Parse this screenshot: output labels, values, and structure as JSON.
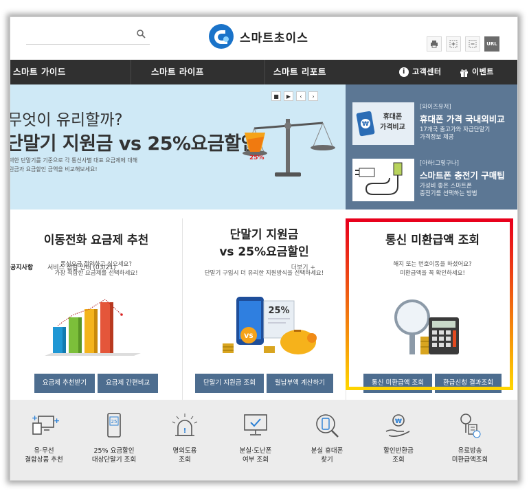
{
  "header": {
    "logo_text": "스마트초이스",
    "search_placeholder": "",
    "tools": [
      "print-icon",
      "zoom-in-icon",
      "zoom-out-icon",
      "url-icon"
    ],
    "url_label": "URL"
  },
  "nav": {
    "items": [
      "스마트 가이드",
      "스마트 라이프",
      "스마트 리포트"
    ],
    "support": "고객센터",
    "event": "이벤트"
  },
  "banner": {
    "subtitle": "무엇이 유리할까?",
    "title": "단말기 지원금 vs 25%요금할인",
    "desc_line1": "택한 단말기를 기준으로 각 통신사별 대표 요금제에 대해",
    "desc_line2": "원금과 요금할인 금액을 비교해보세요!",
    "badge": "25%",
    "notice_label": "공지사항",
    "notice_text": "서비스 점검 안내 (03/21)",
    "notice_more": "더보기 +"
  },
  "side": {
    "cards": [
      {
        "thumb_label_1": "휴대폰",
        "thumb_label_2": "가격비교",
        "tag": "[와이즈유저]",
        "title": "휴대폰 가격 국내외비교",
        "desc_1": "17개국 출고가와 자급단말기",
        "desc_2": "가격정보 제공"
      },
      {
        "tag": "[아하!그렇구나]",
        "title": "스마트폰 충전기 구매팁",
        "desc_1": "가성비 좋은 스마트폰",
        "desc_2": "충전기를 선택하는 방법"
      }
    ]
  },
  "features": [
    {
      "title_1": "이동전화 요금제 추천",
      "title_2": "",
      "desc_1": "통신요금 절약하고 싶으세요?",
      "desc_2": "가장 적합한 요금제를 선택하세요!",
      "buttons": [
        "요금제 추천받기",
        "요금제 간편비교"
      ]
    },
    {
      "title_1": "단말기 지원금",
      "title_2": "vs 25%요금할인",
      "desc_1": "단말기 구입시 더 유리한 지원방식을 선택하세요!",
      "desc_2": "",
      "buttons": [
        "단말기 지원금 조회",
        "월납부액 계산하기"
      ],
      "badge_vs": "VS",
      "badge_pct": "25%"
    },
    {
      "title_1": "통신 미환급액 조회",
      "title_2": "",
      "desc_1": "해지 또는 번호이동을 하셨어요?",
      "desc_2": "미환급액을 꼭 확인하세요!",
      "buttons": [
        "통신 미환급액 조회",
        "환급신청 결과조회"
      ]
    }
  ],
  "quick": [
    {
      "l1": "유·무선",
      "l2": "결합상품 추천",
      "icon": "devices-icon"
    },
    {
      "l1": "25% 요금할인",
      "l2": "대상단말기 조회",
      "icon": "phone-discount-icon",
      "badge": "25"
    },
    {
      "l1": "명의도용",
      "l2": "조회",
      "icon": "alarm-icon"
    },
    {
      "l1": "분실·도난폰",
      "l2": "여부 조회",
      "icon": "monitor-check-icon"
    },
    {
      "l1": "분실 휴대폰",
      "l2": "찾기",
      "icon": "phone-search-icon"
    },
    {
      "l1": "할인반환금",
      "l2": "조회",
      "icon": "refund-hand-icon"
    },
    {
      "l1": "유료방송",
      "l2": "미환급액조회",
      "icon": "broadcast-refund-icon"
    }
  ],
  "colors": {
    "nav_bg": "#303030",
    "banner_bg": "#cfe9f6",
    "side_bg": "#5c7794",
    "button_bg": "#4d6d8f",
    "highlight_top": "#e8001c",
    "highlight_bottom": "#ffd400"
  }
}
